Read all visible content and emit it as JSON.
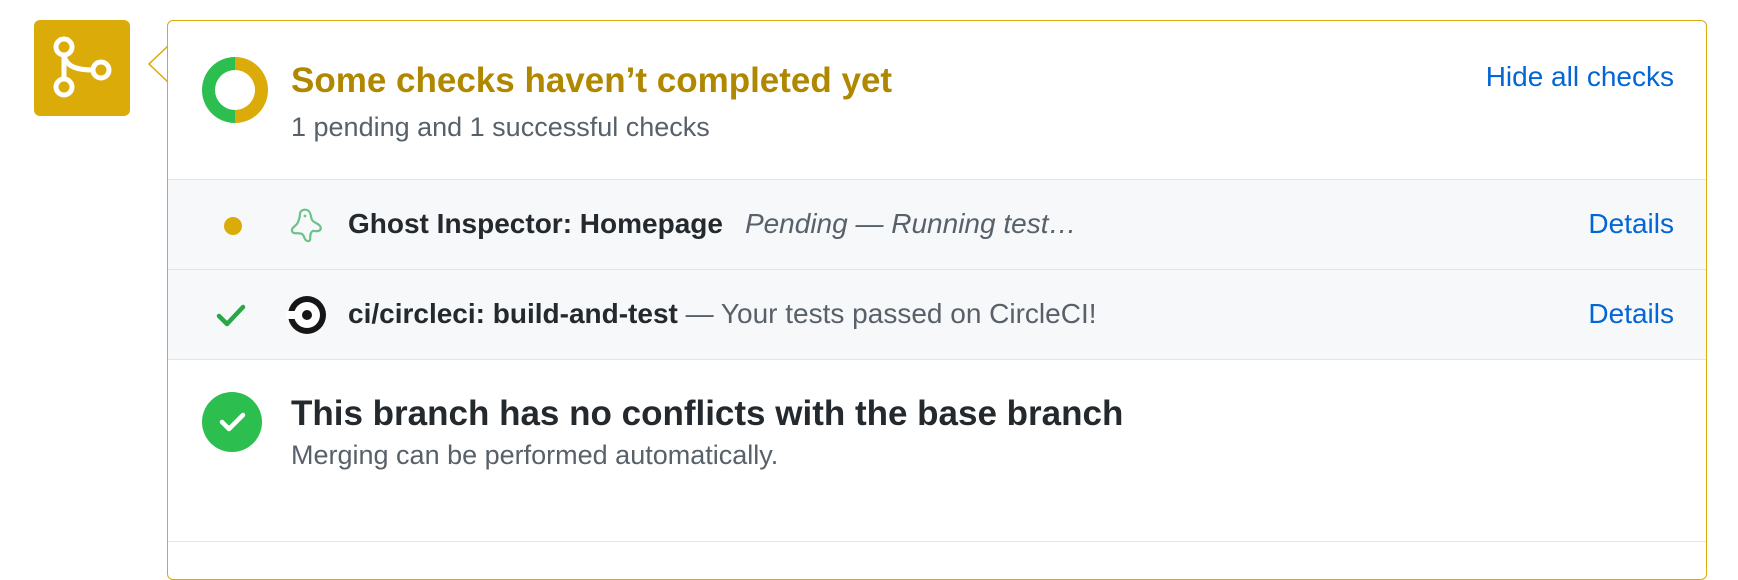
{
  "status": {
    "title": "Some checks haven’t completed yet",
    "subtitle": "1 pending and 1 successful checks",
    "hide_link": "Hide all checks",
    "colors": {
      "pending": "#dbab09",
      "success": "#2cbe4e",
      "link": "#0366d6"
    }
  },
  "checks": [
    {
      "icon": "ghost-inspector-icon",
      "name": "Ghost Inspector: Homepage",
      "description": "Pending — Running test…",
      "state": "pending",
      "details": "Details"
    },
    {
      "icon": "circleci-icon",
      "name": "ci/circleci: build-and-test",
      "description": "— Your tests passed on CircleCI!",
      "state": "success",
      "details": "Details"
    }
  ],
  "merge": {
    "title": "This branch has no conflicts with the base branch",
    "subtitle": "Merging can be performed automatically."
  }
}
